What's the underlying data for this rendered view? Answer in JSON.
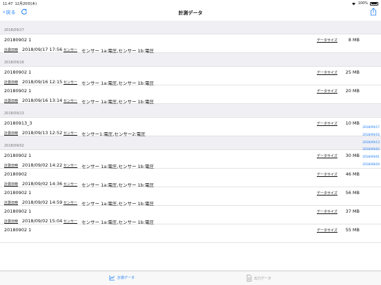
{
  "status": {
    "time": "11:47",
    "date": "12月20日(木)",
    "battery": "100%"
  },
  "nav": {
    "back_label": "戻る",
    "title": "計測データ"
  },
  "labels": {
    "data_size": "データサイズ",
    "measure_date": "計測日時",
    "sensor": "センサー"
  },
  "sections": [
    {
      "date": "2018/09/17",
      "rows": [
        {
          "name": "20180902 1",
          "size": "8 MB",
          "datetime": "2018/09/17 17:56",
          "sensors": "センサー 1a:電圧,センサー 1b:電圧"
        }
      ]
    },
    {
      "date": "2018/09/16",
      "rows": [
        {
          "name": "20180902 1",
          "size": "25 MB",
          "datetime": "2018/09/16 12:15",
          "sensors": "センサー 1a:電圧,センサー 1b:電圧"
        },
        {
          "name": "20180902 1",
          "size": "20 MB",
          "datetime": "2018/09/16 13:14",
          "sensors": "センサー 1a:電圧,センサー 1b:電圧"
        }
      ]
    },
    {
      "date": "2018/09/13",
      "rows": [
        {
          "name": "20180913_3",
          "size": "10 MB",
          "datetime": "2018/09/13 12:52",
          "sensors": "センサー1:電圧,センサー2:電圧"
        }
      ]
    },
    {
      "date": "2018/09/02",
      "rows": [
        {
          "name": "20180902 1",
          "size": "30 MB",
          "datetime": "2018/09/02 14:22",
          "sensors": "センサー 1a:電圧,センサー 1b:電圧"
        },
        {
          "name": "20180902",
          "size": "46 MB",
          "datetime": "2018/09/02 14:36",
          "sensors": "センサー 1a:電圧,センサー 1b:電圧"
        },
        {
          "name": "20180902 1",
          "size": "56 MB",
          "datetime": "2018/09/02 14:59",
          "sensors": "センサー 1a:電圧,センサー 1b:電圧"
        },
        {
          "name": "20180902 1",
          "size": "37 MB",
          "datetime": "2018/09/02 15:04",
          "sensors": "センサー 1a:電圧,センサー 1b:電圧"
        },
        {
          "name": "20180902 1",
          "size": "55 MB",
          "datetime": "",
          "sensors": ""
        }
      ]
    }
  ],
  "section_index": [
    "2018/09/17",
    "2018/09/16",
    "2018/09/13",
    "2018/09/02",
    "2018/09/01",
    "2018/08/29"
  ],
  "tabs": [
    {
      "label": "計測データ",
      "icon": "chart-icon"
    },
    {
      "label": "出力データ",
      "icon": "document-icon"
    }
  ],
  "colors": {
    "accent": "#1a7cf5",
    "section_bg": "#efeff4"
  }
}
